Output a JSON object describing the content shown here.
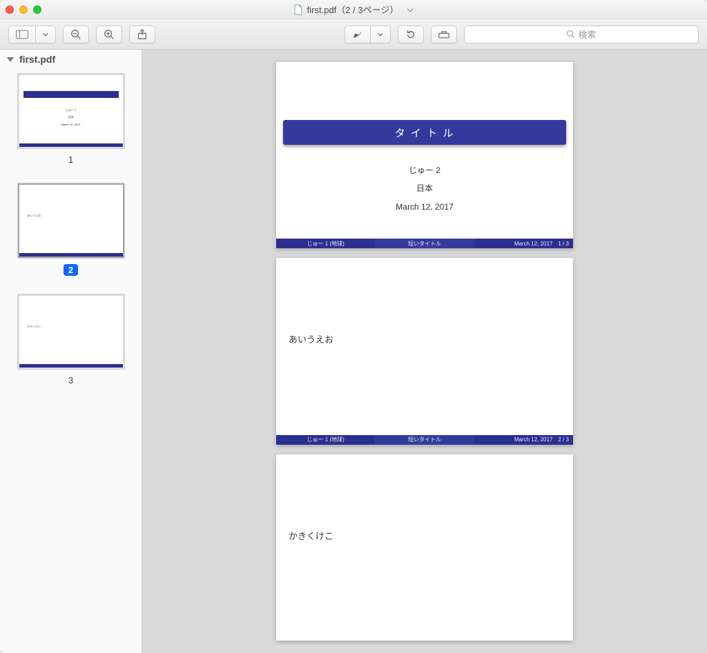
{
  "window": {
    "title": "first.pdf（2 / 3ページ）"
  },
  "sidebar": {
    "filename": "first.pdf",
    "thumbs": [
      {
        "num": "1",
        "selected": false
      },
      {
        "num": "2",
        "selected": true
      },
      {
        "num": "3",
        "selected": false
      }
    ]
  },
  "slides": {
    "title_band": "タ イ ト ル",
    "author": "じゅー 2",
    "affil": "日本",
    "date": "March 12, 2017",
    "page2_text": "あいうえお",
    "page3_text": "かきくけこ",
    "footer_left": "じゅー 1  (地球)",
    "footer_mid": "短いタイトル",
    "footer_right_date": "March 12, 2017",
    "footer_p1": "1 / 3",
    "footer_p2": "2 / 3"
  },
  "thumb_mini": {
    "title": "タイトル",
    "author": "じゅー 2",
    "affil": "日本",
    "date": "March 12, 2017",
    "p2": "あいうえお",
    "p3": "かきくけこ"
  },
  "toolbar": {
    "search_placeholder": "検索"
  }
}
